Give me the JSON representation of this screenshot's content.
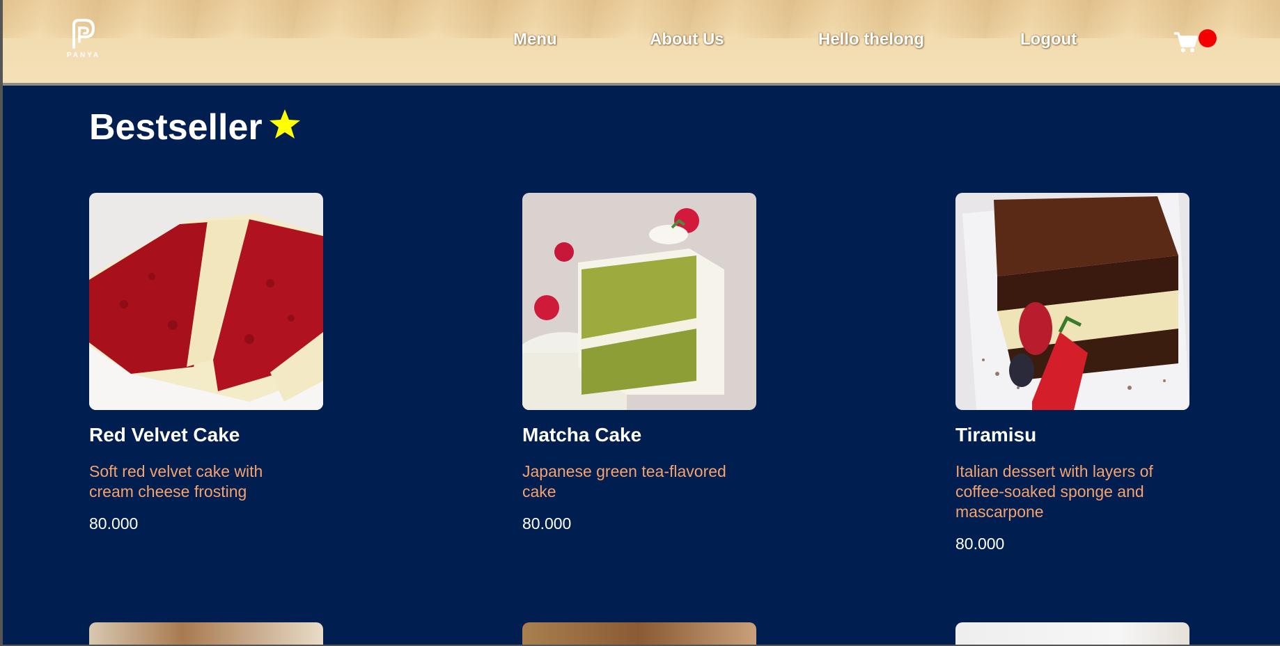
{
  "header": {
    "logo_text": "PANYA",
    "nav": {
      "menu": "Menu",
      "about": "About Us",
      "greeting": "Hello thelong",
      "logout": "Logout"
    },
    "cart_icon": "cart-icon"
  },
  "section": {
    "title": "Bestseller",
    "icon": "star-icon",
    "star_color": "#ffff00"
  },
  "products": [
    {
      "name": "Red Velvet Cake",
      "description": "Soft red velvet cake with cream cheese frosting",
      "price": "80.000"
    },
    {
      "name": "Matcha Cake",
      "description": "Japanese green tea-flavored cake",
      "price": "80.000"
    },
    {
      "name": "Tiramisu",
      "description": "Italian dessert with layers of coffee-soaked sponge and mascarpone",
      "price": "80.000"
    }
  ],
  "colors": {
    "background": "#011e51",
    "header": "#f4e1b9",
    "description": "#f5a36c",
    "cart_badge": "#f40000"
  }
}
